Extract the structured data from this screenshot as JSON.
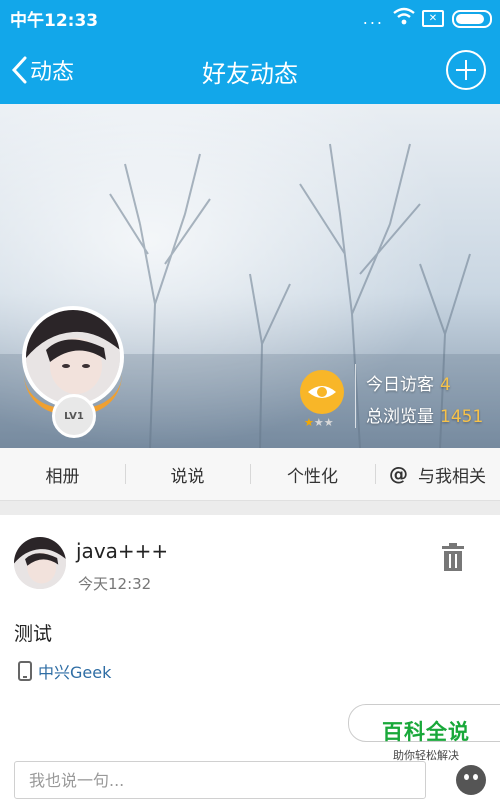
{
  "status_bar": {
    "time": "中午12:33",
    "dots": "...",
    "sim_mark": "✕"
  },
  "title_bar": {
    "back_label": "动态",
    "title": "好友动态"
  },
  "profile": {
    "level": "LV1",
    "visitors_today_label": "今日访客",
    "visitors_today": "4",
    "total_views_label": "总浏览量",
    "total_views": "1451",
    "rating_stars": "★★★",
    "rating_value": 1
  },
  "tabs": [
    "相册",
    "说说",
    "个性化",
    "与我相关"
  ],
  "tab_at_symbol": "@",
  "post": {
    "author": "java+++",
    "time": "今天12:32",
    "text": "测试",
    "device": "中兴Geek"
  },
  "comment": {
    "placeholder": "我也说一句..."
  },
  "watermark": {
    "title": "百科全说",
    "subtitle": "助你轻松解决"
  },
  "colors": {
    "topbar": "#12a7ea",
    "accent_number": "#f7c24a",
    "eye_badge": "#f8b628",
    "watermark": "#19a83a"
  }
}
